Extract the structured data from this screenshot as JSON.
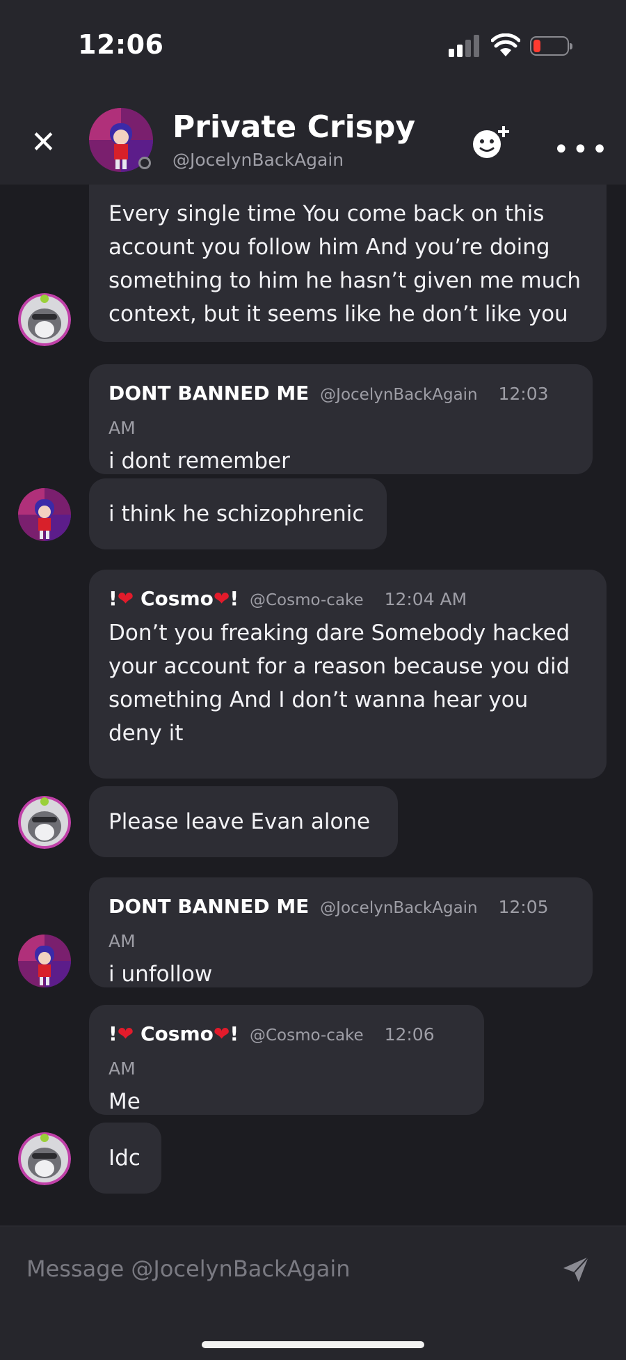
{
  "status_bar": {
    "time": "12:06"
  },
  "header": {
    "title": "Private Crispy",
    "handle": "@JocelynBackAgain"
  },
  "messages": [
    {
      "text": "Every single time You come back on this account you follow him And you’re doing something to him he hasn’t given me much context, but it seems like he don’t like you"
    },
    {
      "name": "DONT BANNED ME",
      "handle": "@JocelynBackAgain",
      "time": "12:03 AM",
      "text": "i dont remember"
    },
    {
      "text": "i think he schizophrenic"
    },
    {
      "name_pre": "!",
      "name_mid": " Cosmo",
      "name_post": "!",
      "handle": "@Cosmo-cake",
      "time": "12:04 AM",
      "text": "Don’t you freaking dare Somebody hacked your account for a reason because you did something And I don’t wanna hear you deny it"
    },
    {
      "text": "Please leave  Evan alone"
    },
    {
      "name": "DONT BANNED ME",
      "handle": "@JocelynBackAgain",
      "time": "12:05 AM",
      "text": "i unfollow"
    },
    {
      "name_pre": "!",
      "name_mid": " Cosmo",
      "name_post": "!",
      "handle": "@Cosmo-cake",
      "time": "12:06 AM",
      "text": "Me"
    },
    {
      "text": "Idc"
    }
  ],
  "composer": {
    "placeholder": "Message @JocelynBackAgain"
  },
  "icons": {
    "close": "close-icon",
    "add_friend": "add-friend-icon",
    "more": "more-icon",
    "send": "send-icon",
    "heart": "heart-icon"
  },
  "colors": {
    "background": "#1c1c21",
    "bubble": "#2d2d34",
    "heart": "#e21b2b",
    "battery_low": "#ff3b30"
  }
}
